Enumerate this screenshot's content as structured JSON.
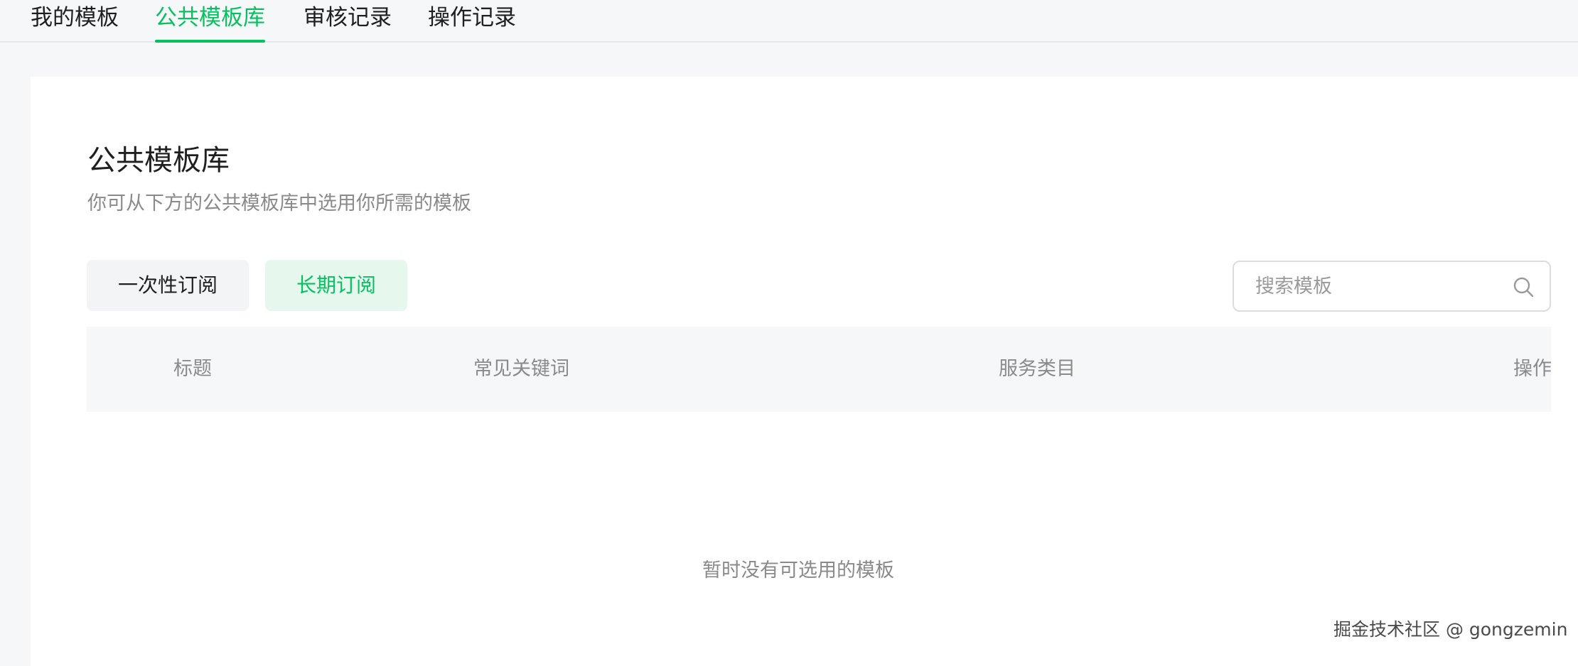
{
  "tabs": [
    {
      "label": "我的模板",
      "active": false
    },
    {
      "label": "公共模板库",
      "active": true
    },
    {
      "label": "审核记录",
      "active": false
    },
    {
      "label": "操作记录",
      "active": false
    }
  ],
  "main": {
    "title": "公共模板库",
    "description": "你可从下方的公共模板库中选用你所需的模板"
  },
  "filters": {
    "one_time_label": "一次性订阅",
    "long_term_label": "长期订阅",
    "selected": "长期订阅"
  },
  "search": {
    "placeholder": "搜索模板",
    "value": "",
    "icon": "search-icon"
  },
  "table": {
    "headers": [
      "标题",
      "常见关键词",
      "服务类目",
      "操作"
    ],
    "rows": [],
    "empty_text": "暂时没有可选用的模板"
  },
  "watermark": "掘金技术社区 @ gongzemin",
  "colors": {
    "accent": "#07c160",
    "accent_bg": "#e6f8ee",
    "text_primary": "#1f1f1f",
    "text_secondary": "#8a8a8a",
    "page_bg": "#f6f7f9"
  }
}
